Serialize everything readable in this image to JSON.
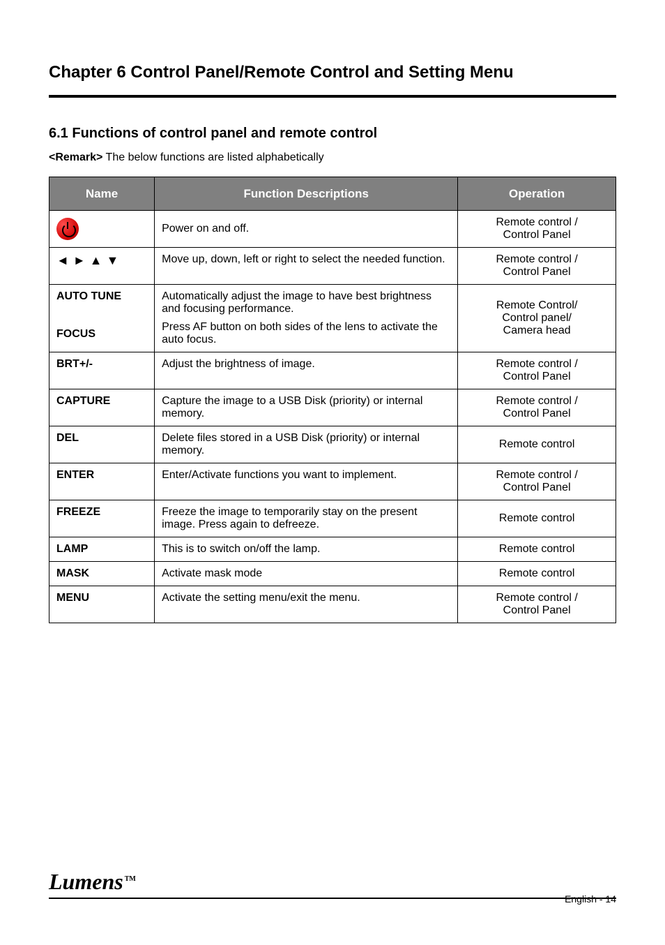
{
  "chapter": "Chapter 6  Control Panel/Remote Control and Setting Menu",
  "section": "6.1 Functions of control panel and remote control",
  "note_prefix": "<Remark>",
  "note_text": " The below functions are listed alphabetically",
  "headers": [
    "Name",
    "Function Descriptions",
    "Operation"
  ],
  "rows": [
    {
      "icon": "power",
      "label": "",
      "desc": "Power on and off.",
      "op": "Remote control /\nControl Panel"
    },
    {
      "icon": "arrows",
      "label": "",
      "desc": "Move up, down, left or right to select the needed function.",
      "op": "Remote control /\nControl Panel"
    },
    {
      "label": "AUTO TUNE",
      "desc": "Automatically adjust the image to have best brightness and focusing performance.",
      "sub_label": "FOCUS",
      "sub_desc": "Press AF button on both sides of the lens to activate the auto focus.",
      "op": "Remote Control/\nControl panel/\nCamera head"
    },
    {
      "label": "BRT+/-",
      "desc": "Adjust the brightness of image.",
      "op": "Remote control /\nControl Panel"
    },
    {
      "label": "CAPTURE",
      "desc": "Capture the image to a USB Disk (priority) or internal memory.",
      "op": "Remote control /\nControl Panel"
    },
    {
      "label": "DEL",
      "desc": "Delete files stored in a USB Disk (priority) or internal memory.",
      "op": "Remote control"
    },
    {
      "label": "ENTER",
      "desc": "Enter/Activate functions you want to implement.",
      "op": "Remote control /\nControl Panel"
    },
    {
      "label": "FREEZE",
      "desc": "Freeze the image to temporarily stay on the present image. Press again to defreeze.",
      "op": "Remote control"
    },
    {
      "label": "LAMP",
      "desc": "This is to switch on/off the lamp.",
      "op": "Remote control"
    },
    {
      "label": "MASK",
      "desc": "Activate mask mode",
      "op": "Remote control"
    },
    {
      "label": "MENU",
      "desc": "Activate the setting menu/exit the menu.",
      "op": "Remote control /\nControl Panel"
    }
  ],
  "page_label": "English - ",
  "page_num": "14"
}
